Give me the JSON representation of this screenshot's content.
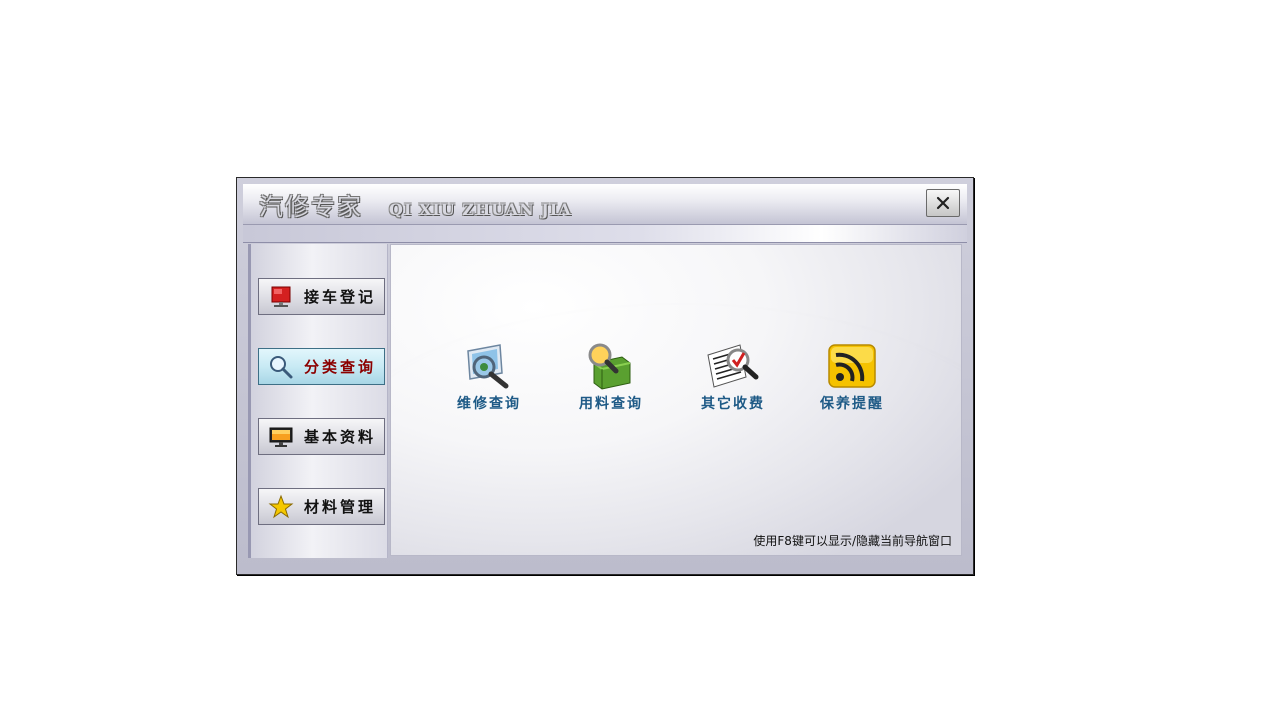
{
  "window": {
    "title_cn": "汽修专家",
    "title_en": "QI XIU ZHUAN JIA"
  },
  "sidebar": {
    "items": [
      {
        "label": "接车登记",
        "icon": "red-screen-icon",
        "active": false
      },
      {
        "label": "分类查询",
        "icon": "magnifier-icon",
        "active": true
      },
      {
        "label": "基本资料",
        "icon": "monitor-icon",
        "active": false
      },
      {
        "label": "材料管理",
        "icon": "star-icon",
        "active": false
      }
    ]
  },
  "main": {
    "shortcuts": [
      {
        "label": "维修查询",
        "icon": "repair-search-icon"
      },
      {
        "label": "用料查询",
        "icon": "material-search-icon"
      },
      {
        "label": "其它收费",
        "icon": "document-search-icon"
      },
      {
        "label": "保养提醒",
        "icon": "rss-icon"
      }
    ],
    "hint": "使用F8键可以显示/隐藏当前导航窗口"
  },
  "colors": {
    "label_blue": "#1e5a86",
    "active_label": "#8b0000",
    "active_bg": "#c8eaf4"
  }
}
